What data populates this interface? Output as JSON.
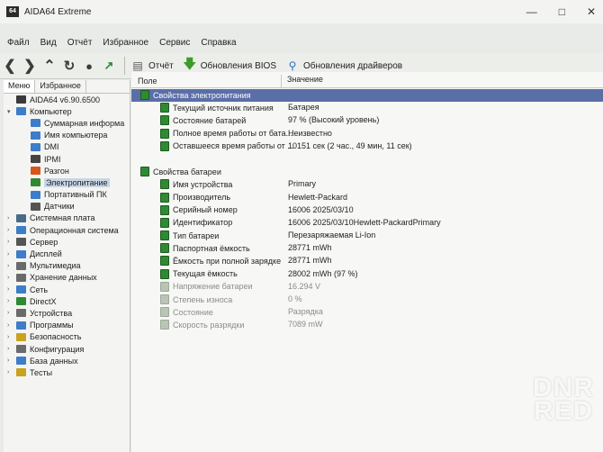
{
  "window": {
    "title": "AIDA64 Extreme",
    "app_icon_text": "64"
  },
  "menu": [
    "Файл",
    "Вид",
    "Отчёт",
    "Избранное",
    "Сервис",
    "Справка"
  ],
  "toolbar": {
    "report_label": "Отчёт",
    "bios_update_label": "Обновления BIOS",
    "driver_update_label": "Обновления драйверов"
  },
  "left": {
    "tabs": [
      "Меню",
      "Избранное"
    ],
    "tree": [
      {
        "label": "AIDA64 v6.90.6500",
        "indent": 0,
        "color": "#3a3a3a",
        "exp": ""
      },
      {
        "label": "Компьютер",
        "indent": 0,
        "color": "#3d7dc9",
        "exp": "v"
      },
      {
        "label": "Суммарная информа",
        "indent": 2,
        "color": "#3d7dc9",
        "exp": ""
      },
      {
        "label": "Имя компьютера",
        "indent": 2,
        "color": "#3d7dc9",
        "exp": ""
      },
      {
        "label": "DMI",
        "indent": 2,
        "color": "#3d7dc9",
        "exp": ""
      },
      {
        "label": "IPMI",
        "indent": 2,
        "color": "#444444",
        "exp": ""
      },
      {
        "label": "Разгон",
        "indent": 2,
        "color": "#d9541e",
        "exp": ""
      },
      {
        "label": "Электропитание",
        "indent": 2,
        "color": "#2f8a33",
        "exp": "",
        "selected": true
      },
      {
        "label": "Портативный ПК",
        "indent": 2,
        "color": "#3d7dc9",
        "exp": ""
      },
      {
        "label": "Датчики",
        "indent": 2,
        "color": "#555555",
        "exp": ""
      },
      {
        "label": "Системная плата",
        "indent": 0,
        "color": "#4a6a8a",
        "exp": ">"
      },
      {
        "label": "Операционная система",
        "indent": 0,
        "color": "#3d7dc9",
        "exp": ">"
      },
      {
        "label": "Сервер",
        "indent": 0,
        "color": "#555555",
        "exp": ">"
      },
      {
        "label": "Дисплей",
        "indent": 0,
        "color": "#3d7dc9",
        "exp": ">"
      },
      {
        "label": "Мультимедиа",
        "indent": 0,
        "color": "#6a6a6a",
        "exp": ">"
      },
      {
        "label": "Хранение данных",
        "indent": 0,
        "color": "#6a6a6a",
        "exp": ">"
      },
      {
        "label": "Сеть",
        "indent": 0,
        "color": "#3d7dc9",
        "exp": ">"
      },
      {
        "label": "DirectX",
        "indent": 0,
        "color": "#2f8a33",
        "exp": ">"
      },
      {
        "label": "Устройства",
        "indent": 0,
        "color": "#6a6a6a",
        "exp": ">"
      },
      {
        "label": "Программы",
        "indent": 0,
        "color": "#3d7dc9",
        "exp": ">"
      },
      {
        "label": "Безопасность",
        "indent": 0,
        "color": "#c9a21e",
        "exp": ">"
      },
      {
        "label": "Конфигурация",
        "indent": 0,
        "color": "#6a6a6a",
        "exp": ">"
      },
      {
        "label": "База данных",
        "indent": 0,
        "color": "#3d7dc9",
        "exp": ">"
      },
      {
        "label": "Тесты",
        "indent": 0,
        "color": "#c9a21e",
        "exp": ">"
      }
    ]
  },
  "columns": {
    "field": "Поле",
    "value": "Значение"
  },
  "rows": [
    {
      "type": "section",
      "field": "Свойства электропитания",
      "value": "",
      "hl": true
    },
    {
      "type": "item",
      "field": "Текущий источник питания",
      "value": "Батарея"
    },
    {
      "type": "item",
      "field": "Состояние батарей",
      "value": "97 % (Высокий уровень)"
    },
    {
      "type": "item",
      "field": "Полное время работы от бата...",
      "value": "Неизвестно"
    },
    {
      "type": "item",
      "field": "Оставшееся время работы от ...",
      "value": "10151 сек (2 час., 49 мин, 11 сек)"
    },
    {
      "type": "blank",
      "field": "",
      "value": ""
    },
    {
      "type": "section",
      "field": "Свойства батареи",
      "value": ""
    },
    {
      "type": "item",
      "field": "Имя устройства",
      "value": "Primary"
    },
    {
      "type": "item",
      "field": "Производитель",
      "value": "Hewlett-Packard"
    },
    {
      "type": "item",
      "field": "Серийный номер",
      "value": "16006 2025/03/10"
    },
    {
      "type": "item",
      "field": "Идентификатор",
      "value": "16006 2025/03/10Hewlett-PackardPrimary"
    },
    {
      "type": "item",
      "field": "Тип батареи",
      "value": "Перезаряжаемая Li-Ion"
    },
    {
      "type": "item",
      "field": "Паспортная ёмкость",
      "value": "28771 mWh"
    },
    {
      "type": "item",
      "field": "Ёмкость при полной зарядке",
      "value": "28771 mWh"
    },
    {
      "type": "item",
      "field": "Текущая ёмкость",
      "value": "28002 mWh  (97 %)"
    },
    {
      "type": "item",
      "field": "Напряжение батареи",
      "value": "16.294 V",
      "dim": true
    },
    {
      "type": "item",
      "field": "Степень износа",
      "value": "0 %",
      "dim": true
    },
    {
      "type": "item",
      "field": "Состояние",
      "value": "Разрядка",
      "dim": true
    },
    {
      "type": "item",
      "field": "Скорость разрядки",
      "value": "7089 mW",
      "dim": true
    }
  ],
  "watermark": {
    "line1": "DNR",
    "line2": "RED"
  }
}
